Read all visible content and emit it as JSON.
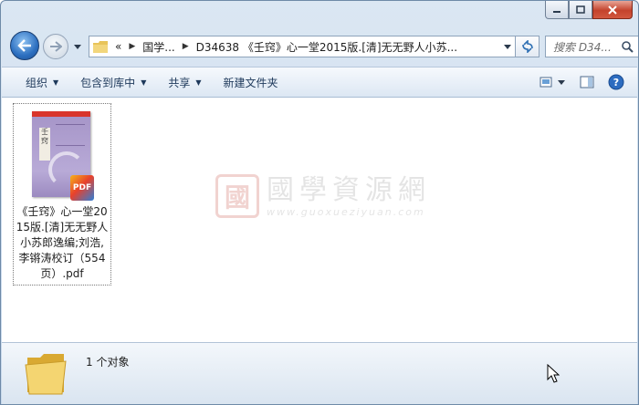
{
  "window": {
    "caption": {
      "min_icon": "minimize-icon",
      "max_icon": "maximize-icon",
      "close_icon": "close-icon"
    }
  },
  "nav": {
    "address": {
      "overflow": "«",
      "segments": [
        "国学...",
        "D34638 《壬窍》心一堂2015版.[清]无无野人小苏..."
      ]
    },
    "search": {
      "placeholder": "搜索 D34..."
    }
  },
  "toolbar": {
    "organize": "组织",
    "include_in_library": "包含到库中",
    "share": "共享",
    "new_folder": "新建文件夹"
  },
  "files": [
    {
      "name": "《壬窍》心一堂2015版.[清]无无野人小苏郎逸编;刘浩, 李锵涛校订（554页）.pdf",
      "badge": "PDF",
      "cover_label": "壬窍"
    }
  ],
  "watermark": {
    "seal": "國",
    "title": "國學資源網",
    "url": "www.guoxueziyuan.com"
  },
  "details": {
    "summary": "1 个对象"
  }
}
